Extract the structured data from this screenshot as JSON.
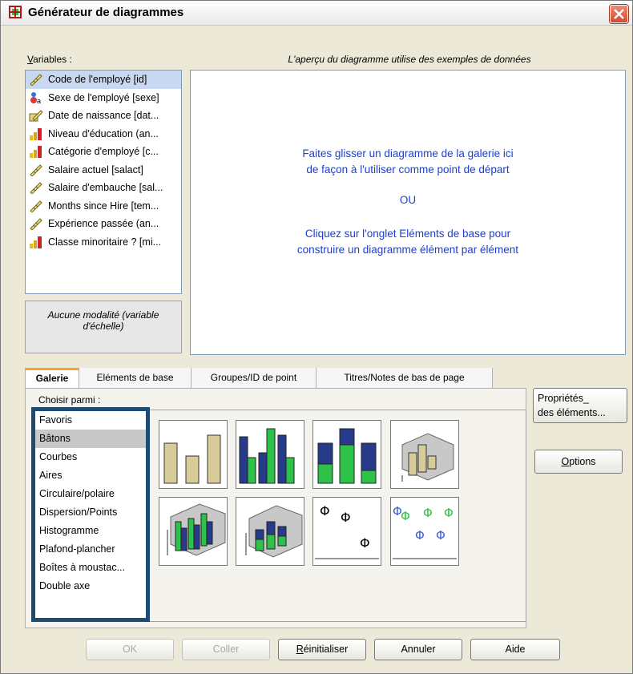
{
  "window": {
    "title": "Générateur de diagrammes"
  },
  "variables": {
    "label_key": "V",
    "label_rest": "ariables :",
    "items": [
      {
        "label": "Code de l'employé [id]",
        "icon": "scale-ruler-icon"
      },
      {
        "label": "Sexe de l'employé [sexe]",
        "icon": "nominal-icon"
      },
      {
        "label": "Date de naissance [dat...",
        "icon": "date-ruler-icon"
      },
      {
        "label": "Niveau d'éducation (an...",
        "icon": "ordinal-icon"
      },
      {
        "label": "Catégorie d'employé [c...",
        "icon": "ordinal-icon"
      },
      {
        "label": "Salaire actuel [salact]",
        "icon": "scale-ruler-icon"
      },
      {
        "label": "Salaire d'embauche [sal...",
        "icon": "scale-ruler-icon"
      },
      {
        "label": "Months since Hire [tem...",
        "icon": "scale-ruler-icon"
      },
      {
        "label": "Expérience passée (an...",
        "icon": "scale-ruler-icon"
      },
      {
        "label": "Classe minoritaire ? [mi...",
        "icon": "ordinal-icon"
      }
    ],
    "info_line1": "Aucune modalité (variable",
    "info_line2": "d'échelle)"
  },
  "preview": {
    "header": "L'aperçu du diagramme utilise des exemples de données",
    "line1": "Faites glisser un diagramme de la galerie ici",
    "line2": "de façon à l'utiliser comme point de départ",
    "or": "OU",
    "line3": "Cliquez sur l'onglet Eléments de base pour",
    "line4": "construire un diagramme élément par élément"
  },
  "tabs": [
    "Galerie",
    "Eléments de base",
    "Groupes/ID de point",
    "Titres/Notes de bas de page"
  ],
  "gallery": {
    "choose_label": "Choisir parmi :",
    "types": [
      "Favoris",
      "Bâtons",
      "Courbes",
      "Aires",
      "Circulaire/polaire",
      "Dispersion/Points",
      "Histogramme",
      "Plafond-plancher",
      "Boîtes à moustac...",
      "Double axe"
    ],
    "selected_type": "Bâtons",
    "thumbnails": [
      "simple-bar-icon",
      "clustered-bar-icon",
      "stacked-bar-icon",
      "3d-bar-icon",
      "3d-clustered-bar-icon",
      "3d-stacked-bar-icon",
      "error-bar-icon",
      "clustered-error-bar-icon"
    ]
  },
  "side_buttons": {
    "properties_line1": "Propriétés_",
    "properties_line2": "des éléments...",
    "options_key": "O",
    "options_rest": "ptions"
  },
  "buttons": {
    "ok": "OK",
    "paste": "Coller",
    "reset_key": "R",
    "reset_rest": "éinitialiser",
    "cancel": "Annuler",
    "help": "Aide"
  },
  "colors": {
    "tan": "#d8cc9a",
    "navy": "#283a8a",
    "green": "#2ec24a",
    "accent_tab": "#f2a33a",
    "list_border": "#1f4a72",
    "link_text": "#1a3fd6"
  }
}
